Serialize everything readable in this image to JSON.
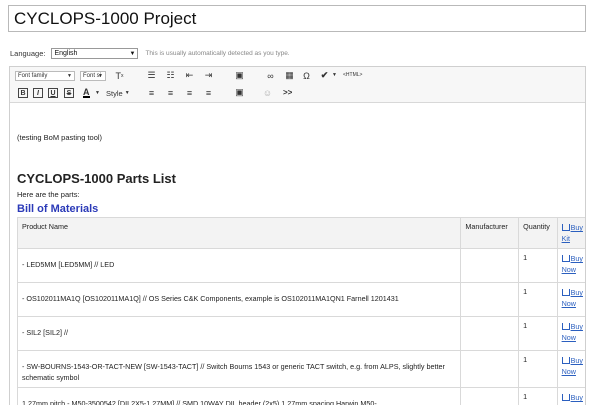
{
  "project_title": "CYCLOPS-1000 Project",
  "language": {
    "label": "Language:",
    "selected": "English",
    "hint": "This is usually automatically detected as you type."
  },
  "toolbar": {
    "font_family": "Font family",
    "font_size": "Font si",
    "style": "Style",
    "html_label": "<HTML>",
    "bold": "B",
    "italic": "I",
    "underline": "U",
    "strike": "S",
    "text_color": "A",
    "more": ">>"
  },
  "content": {
    "testing_line": "(testing BoM pasting tool)",
    "heading": "CYCLOPS-1000 Parts List",
    "intro": "Here are the parts:",
    "subheading": "Bill of Materials"
  },
  "table": {
    "headers": [
      "Product Name",
      "Manufacturer",
      "Quantity",
      "Buy Kit"
    ],
    "buy_now": "Buy Now",
    "rows": [
      {
        "name": "- LED5MM [LED5MM] // LED",
        "manufacturer": "",
        "quantity": "1"
      },
      {
        "name": "- OS102011MA1Q [OS102011MA1Q] // OS Series C&K Components, example is OS102011MA1QN1 Farnell 1201431",
        "manufacturer": "",
        "quantity": "1"
      },
      {
        "name": "- SIL2 [SIL2] //",
        "manufacturer": "",
        "quantity": "1"
      },
      {
        "name": "- SW-BOURNS-1543-OR-TACT-NEW [SW-1543-TACT] // Switch Bourns 1543 or generic TACT switch, e.g. from ALPS, slightly better schematic symbol",
        "manufacturer": "",
        "quantity": "1"
      },
      {
        "name": "1.27mm pitch - M50-3500542 [DIL2X5-1.27MM] // SMD 10WAY DIL header (2x5) 1.27mm spacing Harwin M50-",
        "manufacturer": "",
        "quantity": "1"
      }
    ]
  }
}
